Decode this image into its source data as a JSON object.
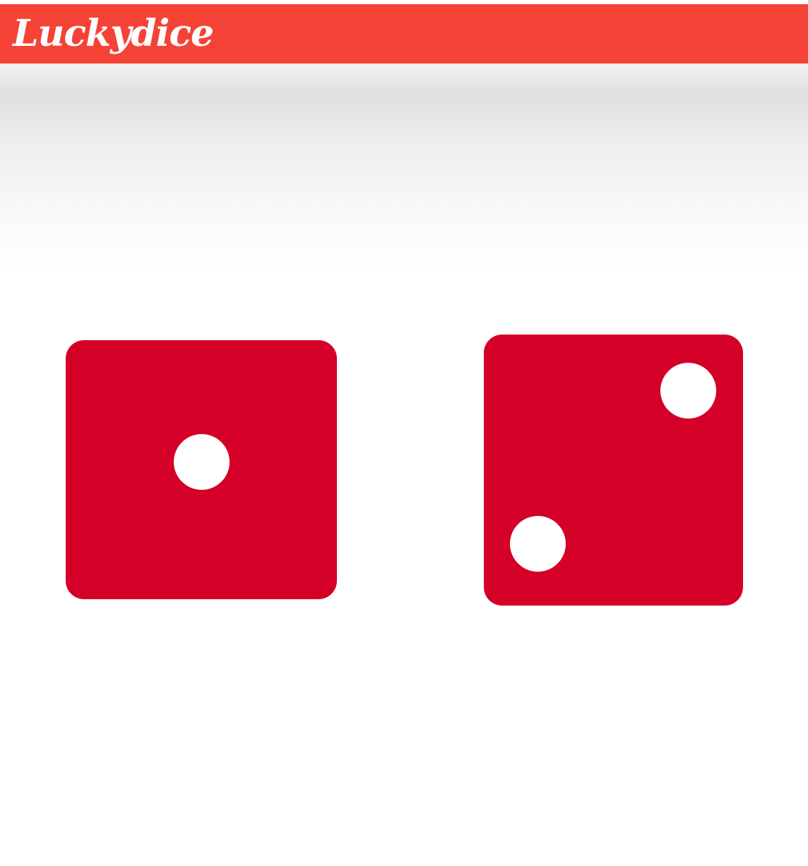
{
  "app_bar": {
    "title": "Luckydice",
    "color": "#f44336"
  },
  "dice": [
    {
      "value": 1,
      "color": "#d50027"
    },
    {
      "value": 2,
      "color": "#d50027"
    }
  ]
}
